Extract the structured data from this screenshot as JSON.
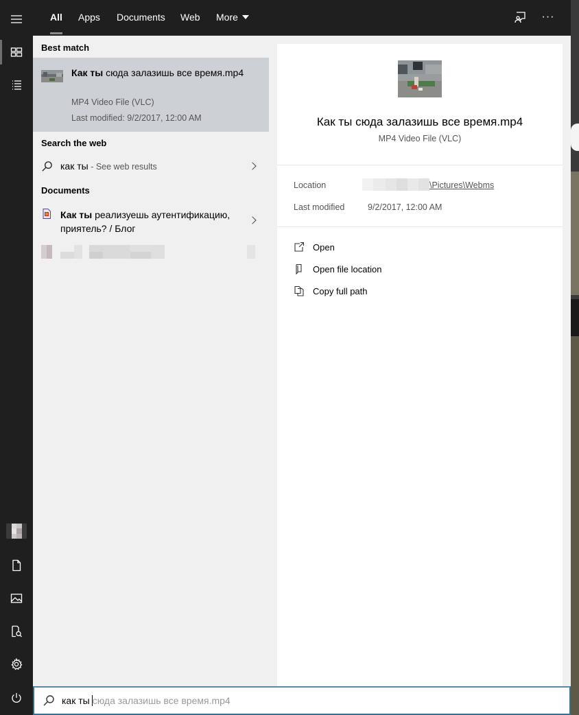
{
  "tabs": [
    {
      "label": "All",
      "active": true
    },
    {
      "label": "Apps"
    },
    {
      "label": "Documents"
    },
    {
      "label": "Web"
    },
    {
      "label": "More"
    }
  ],
  "top_icons": [
    "feedback-icon",
    "more-options-icon"
  ],
  "top_more_label": "···",
  "rail": {
    "top_icons": [
      "hamburger-menu-icon",
      "home-icon",
      "documents-list-icon"
    ],
    "bottom_icons": [
      "user-avatar",
      "document-icon",
      "pictures-icon",
      "file-explorer-icon",
      "settings-icon",
      "power-icon"
    ]
  },
  "sections": {
    "best_match": "Best match",
    "search_web": "Search the web",
    "documents": "Documents"
  },
  "best_match": {
    "title_bold": "Как ты",
    "title_rest": " сюда залазишь все время.mp4",
    "type": "MP4 Video File (VLC)",
    "modified": "Last modified: 9/2/2017, 12:00 AM"
  },
  "web_result": {
    "query": "как ты",
    "suffix": " - See web results"
  },
  "document_result": {
    "title_bold": "Как ты",
    "title_rest": " реализуешь аутентификацию, приятель? / Блог"
  },
  "preview": {
    "title": "Как ты сюда залазишь все время.mp4",
    "type": "MP4 Video File (VLC)",
    "location_label": "Location",
    "location_value": "\\Pictures\\Webms",
    "modified_label": "Last modified",
    "modified_value": "9/2/2017, 12:00 AM",
    "actions": [
      "Open",
      "Open file location",
      "Copy full path"
    ]
  },
  "search": {
    "typed": "как ты",
    "suggestion": "сюда залазишь все время.mp4"
  }
}
